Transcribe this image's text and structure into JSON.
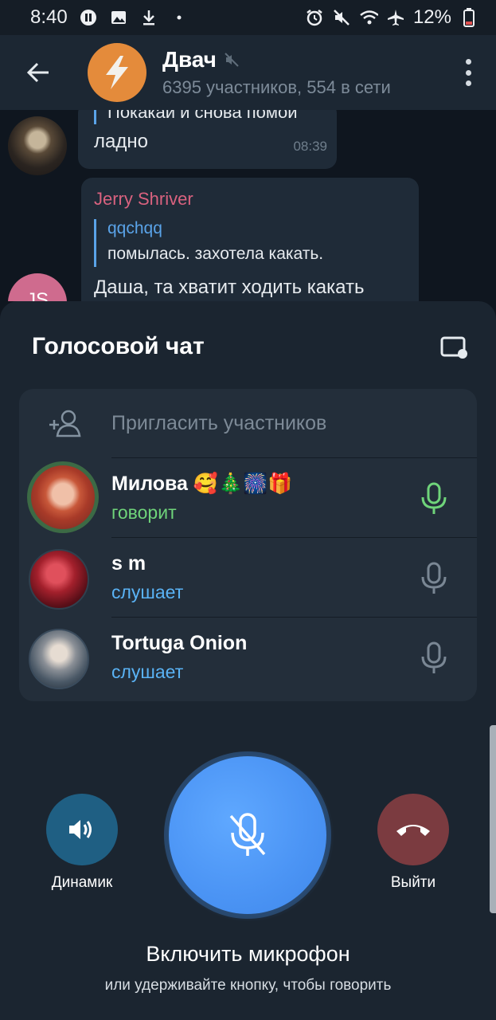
{
  "status_bar": {
    "time": "8:40",
    "battery": "12%"
  },
  "chat": {
    "title": "Двач",
    "subtitle": "6395 участников, 554 в сети"
  },
  "messages": {
    "m1_quote": "Покакай и снова помой",
    "m1_text": "ладно",
    "m1_time": "08:39",
    "m2_author": "Jerry Shriver",
    "m2_reply_author": "qqchqq",
    "m2_reply_text": "помылась. захотела какать.",
    "m2_text": "Даша, та хватит ходить какать",
    "m2_avatar_initials": "JS"
  },
  "voice_chat": {
    "title": "Голосовой чат",
    "invite_label": "Пригласить участников",
    "participants": [
      {
        "name": "Милова 🥰🎄🎆🎁",
        "status": "говорит",
        "status_color": "#6fd47a"
      },
      {
        "name": "s m",
        "status": "слушает",
        "status_color": "#5ab3f5"
      },
      {
        "name": "Tortuga Onion",
        "status": "слушает",
        "status_color": "#5ab3f5"
      }
    ]
  },
  "controls": {
    "speaker_label": "Динамик",
    "leave_label": "Выйти",
    "main_hint": "Включить микрофон",
    "sub_hint": "или удерживайте кнопку, чтобы говорить"
  },
  "colors": {
    "accent_blue": "#4c95f5",
    "speaking_green": "#6fd47a",
    "listening_blue": "#5ab3f5",
    "leave_red": "#7b3b40",
    "speaker_blue": "#1f5f83"
  },
  "icons": [
    "back-arrow-icon",
    "muted-icon",
    "more-icon",
    "pip-icon",
    "add-user-icon",
    "mic-icon",
    "speaker-icon",
    "hangup-icon",
    "mic-off-icon"
  ]
}
